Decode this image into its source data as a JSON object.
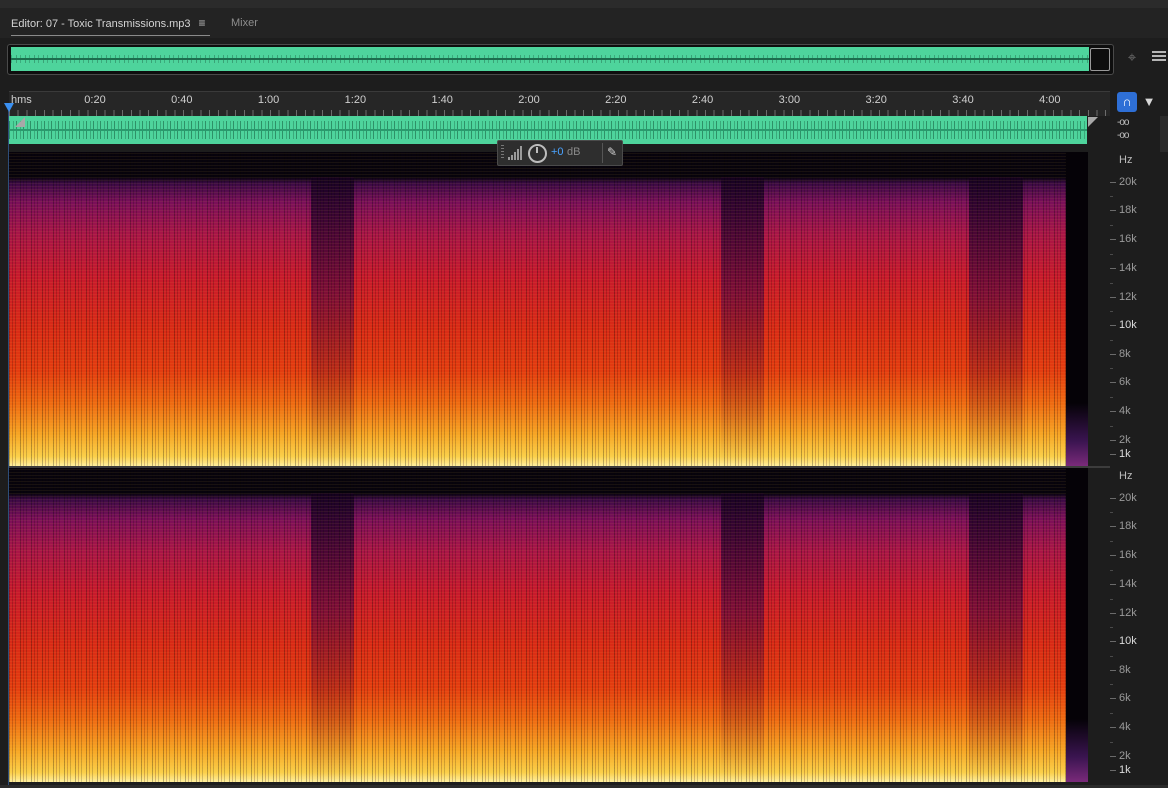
{
  "editor_tab": {
    "label": "Editor: 07 - Toxic Transmissions.mp3",
    "menu_icon": "hamburger-menu-icon"
  },
  "mixer_tab": {
    "label": "Mixer"
  },
  "ruler": {
    "unit_label": "hms",
    "labels": [
      "0:20",
      "0:40",
      "1:00",
      "1:20",
      "1:40",
      "2:00",
      "2:20",
      "2:40",
      "3:00",
      "3:20",
      "3:40",
      "4:00"
    ]
  },
  "meter": {
    "left": "-oo",
    "right": "-oo"
  },
  "hud": {
    "gain_value": "+0",
    "gain_unit": "dB"
  },
  "frequency_axis": {
    "unit": "Hz",
    "labels": [
      "20k",
      "18k",
      "16k",
      "14k",
      "12k",
      "10k",
      "8k",
      "6k",
      "4k",
      "2k",
      "1k"
    ]
  },
  "colors": {
    "waveform": "#4ed49c",
    "accent": "#2e6fd6",
    "hud_value": "#4aa3ff",
    "background": "#1d1d1d"
  },
  "icons": {
    "zoom": "zoom-target-icon",
    "panel_menu": "panel-menu-icon",
    "snap": "snap-magnet-icon",
    "marker": "marker-pin-icon",
    "volume": "volume-bars-icon",
    "knob": "gain-knob-icon",
    "pin": "pin-icon"
  }
}
